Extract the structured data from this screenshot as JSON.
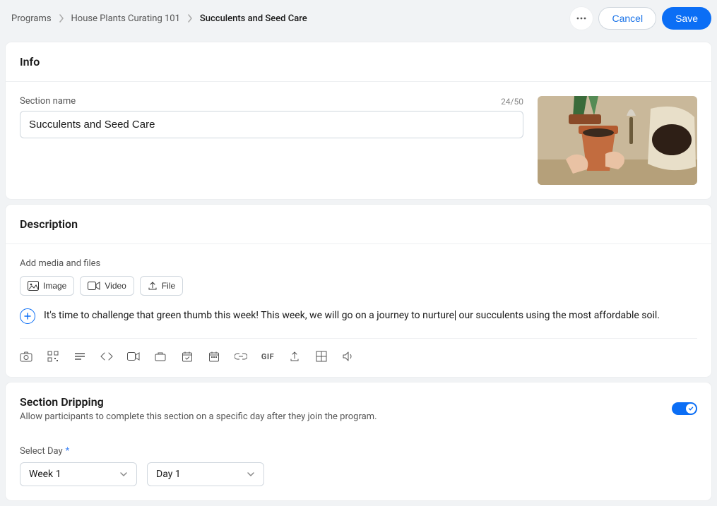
{
  "breadcrumb": {
    "programs": "Programs",
    "course": "House Plants Curating 101",
    "current": "Succulents and Seed Care"
  },
  "actions": {
    "cancel": "Cancel",
    "save": "Save"
  },
  "info": {
    "heading": "Info",
    "sectionNameLabel": "Section name",
    "sectionNameValue": "Succulents and Seed Care",
    "charCount": "24/50"
  },
  "description": {
    "heading": "Description",
    "mediaLabel": "Add media and files",
    "mediaButtons": {
      "image": "Image",
      "video": "Video",
      "file": "File"
    },
    "textBefore": "It's time to challenge that green thumb this week! This week, we will go on a journey to nurture",
    "textAfter": " our succulents using the most affordable soil.",
    "toolbar": {
      "gif": "GIF"
    }
  },
  "dripping": {
    "heading": "Section Dripping",
    "subtitle": "Allow participants to complete this section on a specific day after they join the program.",
    "selectDayLabel": "Select Day",
    "week": "Week 1",
    "day": "Day 1"
  }
}
